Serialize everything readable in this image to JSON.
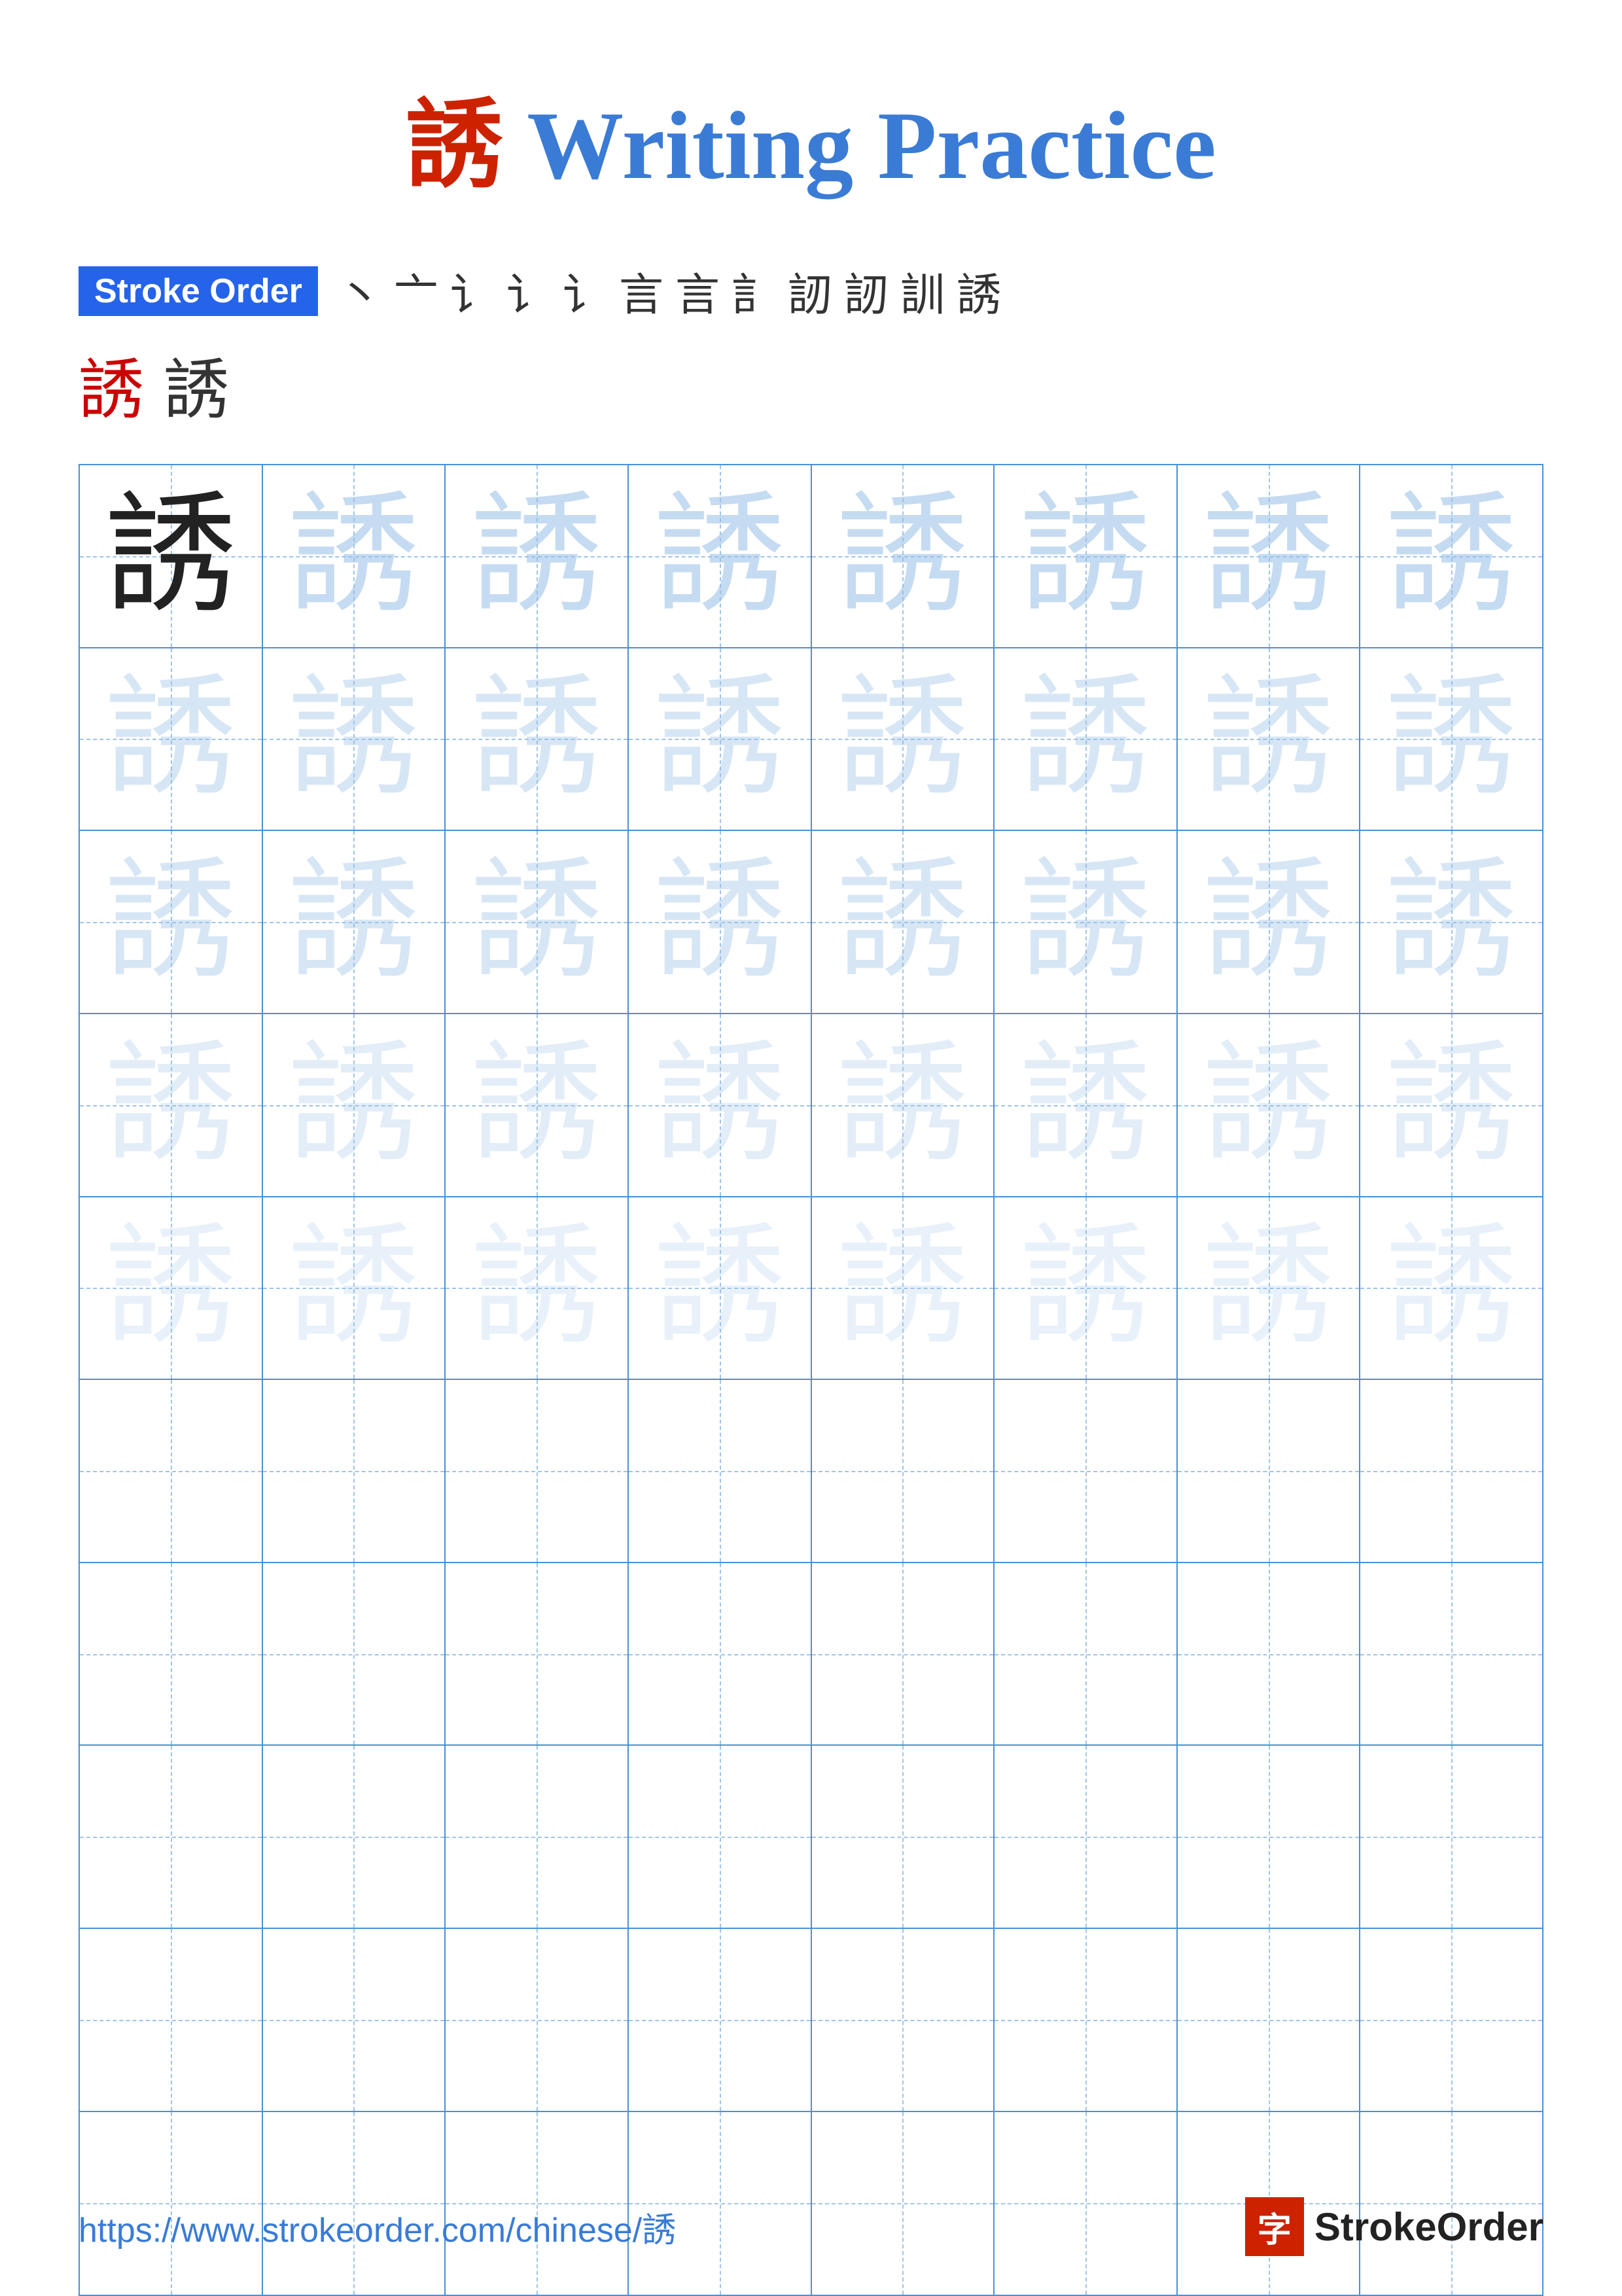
{
  "title": {
    "char": "誘",
    "text": " Writing Practice"
  },
  "stroke_order": {
    "label": "Stroke Order",
    "strokes": [
      "丶",
      "一",
      "ㄧ",
      "ㄧ",
      "㇀",
      "言",
      "言",
      "言",
      "訁",
      "訒",
      "訒",
      "誘"
    ],
    "bottom_chars": [
      "誘",
      "誘"
    ]
  },
  "grid": {
    "char": "誘",
    "cols": 8,
    "filled_rows": 5,
    "empty_rows": 5
  },
  "footer": {
    "url": "https://www.strokeorder.com/chinese/誘",
    "logo_char": "字",
    "logo_text": "StrokeOrder"
  }
}
